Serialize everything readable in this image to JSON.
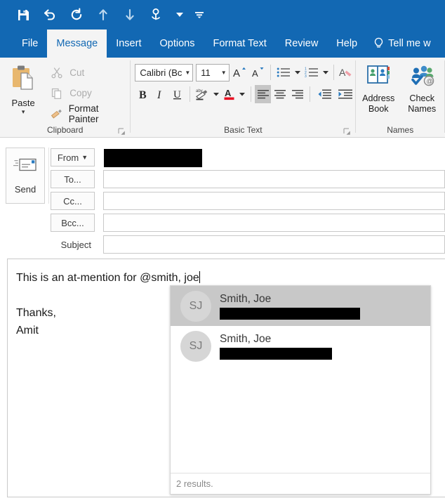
{
  "quick_access": {
    "items": [
      {
        "name": "save-icon",
        "label": "Save"
      },
      {
        "name": "undo-icon",
        "label": "Undo"
      },
      {
        "name": "redo-icon",
        "label": "Redo"
      },
      {
        "name": "previous-item-icon",
        "label": "Previous Item"
      },
      {
        "name": "next-item-icon",
        "label": "Next Item"
      },
      {
        "name": "touch-mode-icon",
        "label": "Touch/Mouse Mode"
      }
    ],
    "touch_caret": "▾",
    "customize_caret": "≡"
  },
  "tabs": [
    {
      "label": "File",
      "active": false
    },
    {
      "label": "Message",
      "active": true
    },
    {
      "label": "Insert",
      "active": false
    },
    {
      "label": "Options",
      "active": false
    },
    {
      "label": "Format Text",
      "active": false
    },
    {
      "label": "Review",
      "active": false
    },
    {
      "label": "Help",
      "active": false
    }
  ],
  "tell_me": {
    "label": "Tell me w",
    "icon": "lightbulb-icon"
  },
  "ribbon": {
    "clipboard": {
      "group_label": "Clipboard",
      "paste": {
        "label": "Paste",
        "caret": "▾"
      },
      "items": [
        {
          "label": "Cut",
          "icon": "scissors-icon",
          "disabled": true
        },
        {
          "label": "Copy",
          "icon": "copy-icon",
          "disabled": true
        },
        {
          "label": "Format Painter",
          "icon": "paintbrush-icon",
          "disabled": false
        }
      ]
    },
    "basic_text": {
      "group_label": "Basic Text",
      "font_name": "Calibri (Bc",
      "font_size": "11",
      "caret": "▾",
      "buttons": [
        {
          "name": "grow-font-button",
          "glyph": "A"
        },
        {
          "name": "shrink-font-button",
          "glyph": "A"
        },
        {
          "name": "bullets-button",
          "glyph": "bullets-icon"
        },
        {
          "name": "numbering-button",
          "glyph": "numbering-icon"
        },
        {
          "name": "clear-formatting-button",
          "glyph": "clear-format-icon"
        },
        {
          "name": "bold-button",
          "glyph": "B"
        },
        {
          "name": "italic-button",
          "glyph": "I"
        },
        {
          "name": "underline-button",
          "glyph": "U"
        },
        {
          "name": "text-highlight-button",
          "glyph": "highlight-icon"
        },
        {
          "name": "font-color-button",
          "glyph": "A"
        },
        {
          "name": "align-left-button",
          "glyph": "align-left-icon"
        },
        {
          "name": "align-center-button",
          "glyph": "align-center-icon"
        },
        {
          "name": "align-right-button",
          "glyph": "align-right-icon"
        },
        {
          "name": "decrease-indent-button",
          "glyph": "decrease-indent-icon"
        },
        {
          "name": "increase-indent-button",
          "glyph": "increase-indent-icon"
        }
      ],
      "font_color": "#E81123"
    },
    "names": {
      "group_label": "Names",
      "address_book": {
        "line1": "Address",
        "line2": "Book"
      },
      "check_names": {
        "line1": "Check",
        "line2": "Names"
      }
    }
  },
  "compose": {
    "send_label": "Send",
    "from_label": "From",
    "from_caret": "▾",
    "from_value_redacted": true,
    "to_label": "To...",
    "to_value": "",
    "cc_label": "Cc...",
    "cc_value": "",
    "bcc_label": "Bcc...",
    "bcc_value": "",
    "subject_label": "Subject",
    "subject_value": ""
  },
  "body": {
    "line1": "This is an at-mention for @smith, joe",
    "line2": "Thanks,",
    "line3": "Amit"
  },
  "autocomplete": {
    "results": [
      {
        "avatar": "SJ",
        "name": "Smith, Joe",
        "email_redacted": true,
        "selected": true
      },
      {
        "avatar": "SJ",
        "name": "Smith, Joe",
        "email_redacted": true,
        "selected": false
      }
    ],
    "footer": "2 results."
  },
  "colors": {
    "brand_blue": "#1268B3",
    "ribbon_bg": "#F4F4F4",
    "selection_gray": "#C8C8C8"
  }
}
